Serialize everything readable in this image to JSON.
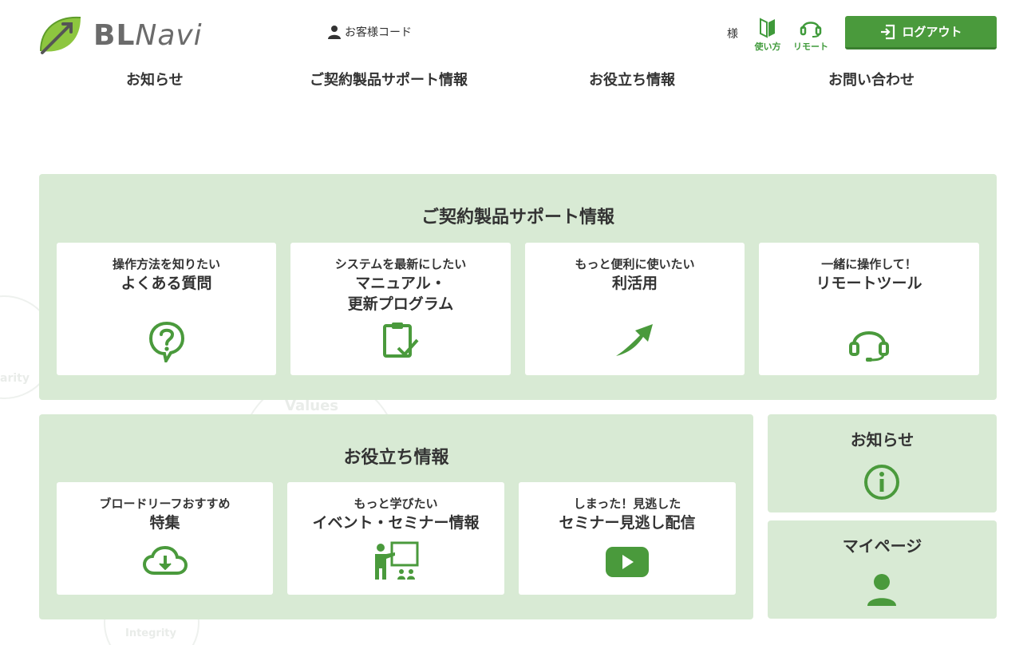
{
  "header": {
    "logo_text_bl": "BL",
    "logo_text_navi": "Navi",
    "customer_code_label": "お客様コード",
    "honorific": "様",
    "howto_label": "使い方",
    "remote_label": "リモート",
    "logout_label": "ログアウト"
  },
  "nav": {
    "items": [
      "お知らせ",
      "ご契約製品サポート情報",
      "お役立ち情報",
      "お問い合わせ"
    ]
  },
  "support": {
    "title": "ご契約製品サポート情報",
    "cards": [
      {
        "sub": "操作方法を知りたい",
        "main": "よくある質問",
        "icon": "question-icon"
      },
      {
        "sub": "システムを最新にしたい",
        "main": "マニュアル・",
        "main2": "更新プログラム",
        "icon": "clipboard-check-icon"
      },
      {
        "sub": "もっと便利に使いたい",
        "main": "利活用",
        "icon": "arrow-up-icon"
      },
      {
        "sub": "一緒に操作して！",
        "main": "リモートツール",
        "icon": "headset-icon"
      }
    ]
  },
  "useful": {
    "title": "お役立ち情報",
    "cards": [
      {
        "sub": "ブロードリーフおすすめ",
        "main": "特集",
        "icon": "cloud-download-icon"
      },
      {
        "sub": "もっと学びたい",
        "main": "イベント・セミナー情報",
        "icon": "presentation-icon"
      },
      {
        "sub": "しまった！見逃した",
        "main": "セミナー見逃し配信",
        "icon": "play-video-icon"
      }
    ]
  },
  "side": {
    "news_title": "お知らせ",
    "mypage_title": "マイページ"
  },
  "background": {
    "words": [
      "Values",
      "Integrity",
      "arity"
    ]
  },
  "colors": {
    "accent": "#4a9a3c",
    "panel": "#d8ead4",
    "text": "#333333"
  }
}
